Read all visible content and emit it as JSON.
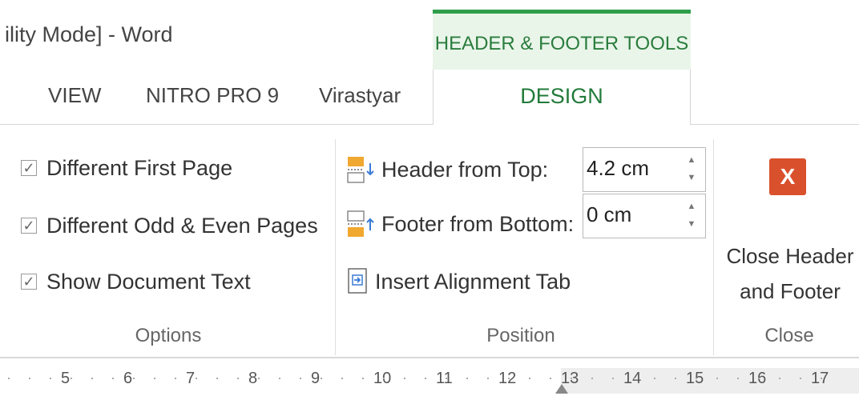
{
  "window": {
    "title": "ility Mode] - Word"
  },
  "context_group": {
    "label": "HEADER & FOOTER TOOLS"
  },
  "tabs": [
    {
      "label": "VIEW"
    },
    {
      "label": "NITRO PRO 9"
    },
    {
      "label": "Virastyar"
    },
    {
      "label": "DESIGN",
      "active": true
    }
  ],
  "options": {
    "group_label": "Options",
    "checkboxes": [
      {
        "label": "Different First Page",
        "checked": true
      },
      {
        "label": "Different Odd & Even Pages",
        "checked": true
      },
      {
        "label": "Show Document Text",
        "checked": true
      }
    ]
  },
  "position": {
    "group_label": "Position",
    "header_from_top": {
      "label": "Header from Top:",
      "value": "4.2 cm"
    },
    "footer_from_bottom": {
      "label": "Footer from Bottom:",
      "value": "0 cm"
    },
    "insert_alignment_tab": {
      "label": "Insert Alignment Tab"
    }
  },
  "close": {
    "group_label": "Close",
    "button_line1": "Close Header",
    "button_line2": "and Footer",
    "icon_glyph": "X"
  },
  "ruler": {
    "numbers": [
      "5",
      "6",
      "7",
      "8",
      "9",
      "10",
      "11",
      "12",
      "13",
      "14",
      "15",
      "16",
      "17"
    ]
  },
  "colors": {
    "accent_green": "#2e9e4a",
    "close_red": "#d9502d"
  }
}
